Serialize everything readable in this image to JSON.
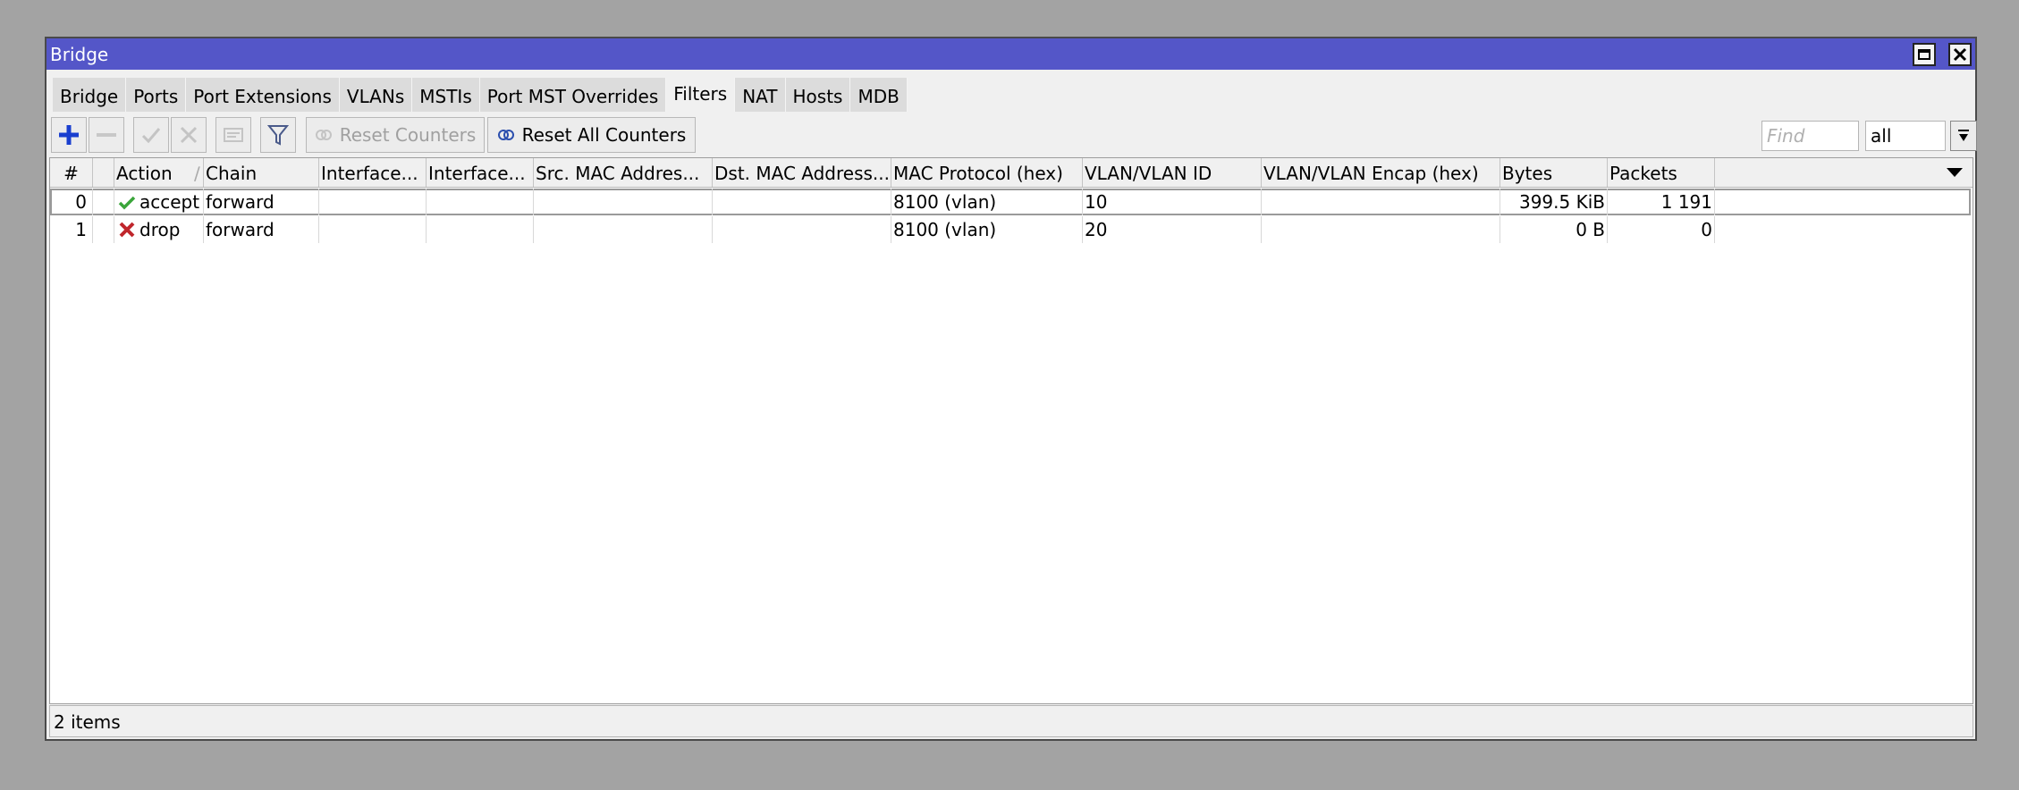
{
  "window": {
    "title": "Bridge"
  },
  "tabs": [
    {
      "label": "Bridge"
    },
    {
      "label": "Ports"
    },
    {
      "label": "Port Extensions"
    },
    {
      "label": "VLANs"
    },
    {
      "label": "MSTIs"
    },
    {
      "label": "Port MST Overrides"
    },
    {
      "label": "Filters"
    },
    {
      "label": "NAT"
    },
    {
      "label": "Hosts"
    },
    {
      "label": "MDB"
    }
  ],
  "active_tab": "Filters",
  "toolbar": {
    "reset_counters": "Reset Counters",
    "reset_all_counters": "Reset All Counters",
    "find_placeholder": "Find",
    "filter_value": "all"
  },
  "table": {
    "columns": [
      "#",
      "",
      "Action",
      "Chain",
      "Interface...",
      "Interface...",
      "Src. MAC Addres...",
      "Dst. MAC Address...",
      "MAC Protocol (hex)",
      "VLAN/VLAN ID",
      "VLAN/VLAN Encap (hex)",
      "Bytes",
      "Packets"
    ],
    "rows": [
      {
        "num": "0",
        "action": "accept",
        "chain": "forward",
        "in_if": "",
        "out_if": "",
        "src_mac": "",
        "dst_mac": "",
        "mac_protocol": "8100 (vlan)",
        "vlan_id": "10",
        "vlan_encap": "",
        "bytes": "399.5 KiB",
        "packets": "1 191"
      },
      {
        "num": "1",
        "action": "drop",
        "chain": "forward",
        "in_if": "",
        "out_if": "",
        "src_mac": "",
        "dst_mac": "",
        "mac_protocol": "8100 (vlan)",
        "vlan_id": "20",
        "vlan_encap": "",
        "bytes": "0 B",
        "packets": "0"
      }
    ]
  },
  "status": {
    "items": "2 items"
  },
  "icons": {
    "add": "plus-icon",
    "remove": "minus-icon",
    "enable": "check-icon",
    "disable": "x-icon",
    "comment": "comment-icon",
    "filter": "funnel-icon",
    "accept": "check-icon",
    "drop": "x-icon"
  },
  "colors": {
    "titlebar": "#5456c8",
    "accept": "#3aa53a",
    "drop": "#c0262c",
    "add": "#1a3fcf"
  }
}
